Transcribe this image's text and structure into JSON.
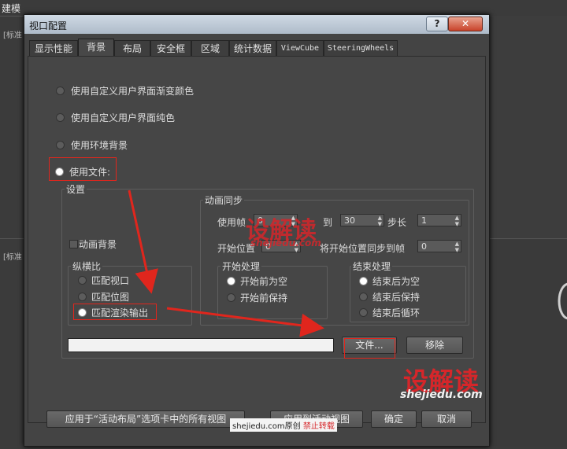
{
  "background": {
    "app_title": "建模",
    "viewport_label": "[标准"
  },
  "dialog": {
    "title": "视口配置",
    "help_glyph": "?",
    "close_glyph": "✕"
  },
  "tabs": [
    {
      "label": "显示性能"
    },
    {
      "label": "背景"
    },
    {
      "label": "布局"
    },
    {
      "label": "安全框"
    },
    {
      "label": "区域"
    },
    {
      "label": "统计数据"
    },
    {
      "label": "ViewCube"
    },
    {
      "label": "SteeringWheels"
    }
  ],
  "active_tab": "背景",
  "background_options": [
    {
      "label": "使用自定义用户界面渐变颜色",
      "selected": false
    },
    {
      "label": "使用自定义用户界面纯色",
      "selected": false
    },
    {
      "label": "使用环境背景",
      "selected": false
    },
    {
      "label": "使用文件:",
      "selected": true
    }
  ],
  "settings": {
    "title": "设置",
    "animate_background": {
      "label": "动画背景",
      "checked": false
    },
    "aspect_ratio": {
      "title": "纵横比",
      "options": [
        {
          "label": "匹配视口",
          "selected": false
        },
        {
          "label": "匹配位图",
          "selected": false
        },
        {
          "label": "匹配渲染输出",
          "selected": true
        }
      ]
    },
    "animation_sync": {
      "title": "动画同步",
      "use_frame_label": "使用帧",
      "use_frame_value": "0",
      "to_label": "到",
      "to_value": "30",
      "step_label": "步长",
      "step_value": "1",
      "start_at_label": "开始位置",
      "start_at_value": "0",
      "sync_start_label": "将开始位置同步到帧",
      "sync_start_value": "0"
    },
    "start_processing": {
      "title": "开始处理",
      "options": [
        {
          "label": "开始前为空",
          "selected": true
        },
        {
          "label": "开始前保持",
          "selected": false
        }
      ]
    },
    "end_processing": {
      "title": "结束处理",
      "options": [
        {
          "label": "结束后为空",
          "selected": true
        },
        {
          "label": "结束后保持",
          "selected": false
        },
        {
          "label": "结束后循环",
          "selected": false
        }
      ]
    },
    "file_path_value": "",
    "files_button": "文件...",
    "remove_button": "移除"
  },
  "footer": {
    "apply_all_button": "应用于“活动布局”选项卡中的所有视图",
    "apply_active_button": "应用到活动视图",
    "ok_button": "确定",
    "cancel_button": "取消"
  },
  "watermark": {
    "brand": "设解读",
    "site": "shejiedu.com",
    "credit_site": "shejiedu.com",
    "credit_original": "原创",
    "credit_forbid": "禁止转载"
  },
  "colors": {
    "annotation_red": "#e0261d",
    "dialog_bg": "#444444",
    "titlebar": "#bcc8d5"
  }
}
